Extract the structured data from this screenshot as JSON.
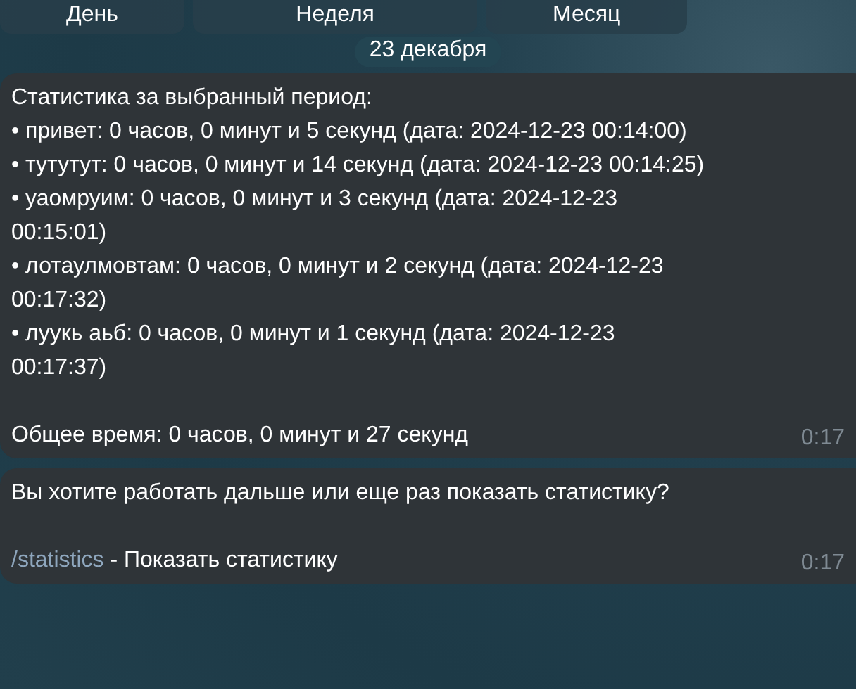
{
  "keyboard_buttons": [
    {
      "label": "День"
    },
    {
      "label": "Неделя"
    },
    {
      "label": "Месяц"
    }
  ],
  "date_badge": "23 декабря",
  "messages": [
    {
      "kind": "stats",
      "heading": "Статистика за выбранный период:",
      "items": [
        "• привет: 0 часов, 0 минут и 5 секунд (дата: 2024-12-23 00:14:00)",
        "• тутутут: 0 часов, 0 минут и 14 секунд (дата: 2024-12-23 00:14:25)",
        "• уаомруим: 0 часов, 0 минут и 3 секунд (дата: 2024-12-23 00:15:01)",
        "• лотаулмовтам: 0 часов, 0 минут и 2 секунд (дата: 2024-12-23 00:17:32)",
        "• луукь аьб: 0 часов, 0 минут и 1 секунд (дата: 2024-12-23 00:17:37)"
      ],
      "total": "Общее время: 0 часов, 0 минут и 27 секунд",
      "time": "0:17"
    },
    {
      "kind": "prompt",
      "text": "Вы хотите работать дальше или еще раз показать статистику?",
      "command": "/statistics",
      "command_text": " - Показать статистику",
      "time": "0:17"
    }
  ]
}
